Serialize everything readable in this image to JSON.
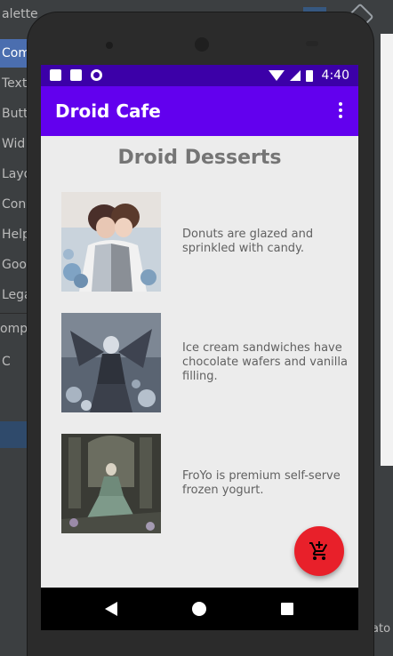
{
  "ide": {
    "palette_header": "alette",
    "palette_items": [
      "Com",
      "Text",
      "Butt",
      "Wid",
      "Layo",
      "Con",
      "Help",
      "Goo",
      "Lega"
    ],
    "component_tree_label": "omp",
    "tree_rows": [
      "C",
      "",
      "",
      ""
    ],
    "right_bottom_text": "ato"
  },
  "status_bar": {
    "time": "4:40"
  },
  "app_bar": {
    "title": "Droid Cafe"
  },
  "content": {
    "heading": "Droid Desserts",
    "items": [
      {
        "name": "donut",
        "description": "Donuts are glazed and sprinkled with candy."
      },
      {
        "name": "ice-cream-sandwich",
        "description": "Ice cream sandwiches have chocolate wafers and vanilla filling."
      },
      {
        "name": "froyo",
        "description": "FroYo is premium self-serve frozen yogurt."
      }
    ]
  },
  "colors": {
    "app_bar": "#6200ee",
    "status_bar": "#3c00a8",
    "fab": "#e8202a",
    "screen_bg": "#ececec",
    "text_secondary": "#616161"
  },
  "icons": {
    "fab": "add-shopping-cart-icon",
    "overflow": "more-vert-icon",
    "nav": [
      "back-icon",
      "home-icon",
      "recents-icon"
    ]
  }
}
